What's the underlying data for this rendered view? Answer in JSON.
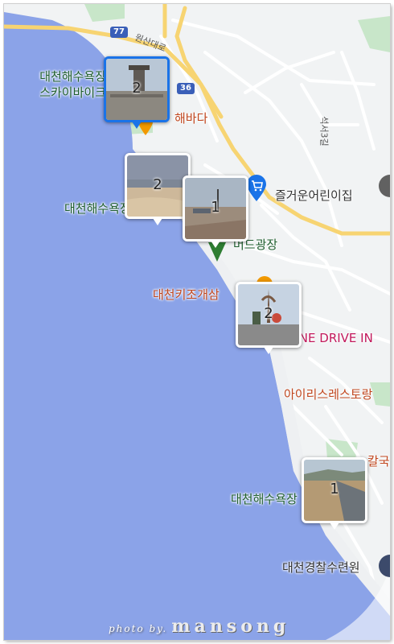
{
  "map": {
    "colors": {
      "sea": "#8ba3e8",
      "land": "#f1f3f4",
      "road_major": "#f7d472",
      "road_minor": "#ffffff",
      "park": "#c8e6c9",
      "selected": "#1a73e8"
    },
    "roads": [
      {
        "number": "77",
        "name": "원산대로"
      },
      {
        "number": "36"
      }
    ],
    "street_labels": [
      "석서3길"
    ],
    "places": [
      {
        "name": "대천해수욕장\n스카이바이크",
        "kind": "park"
      },
      {
        "name": "해바다",
        "kind": "food"
      },
      {
        "name": "즐거운어린이집",
        "kind": "school"
      },
      {
        "name": "대천해수욕장",
        "kind": "park"
      },
      {
        "name": "머드광장",
        "kind": "landmark"
      },
      {
        "name": "대천키조개삼",
        "kind": "food"
      },
      {
        "name": "ONE DRIVE IN",
        "kind": "shop"
      },
      {
        "name": "아이리스레스토랑",
        "kind": "food"
      },
      {
        "name": "칼국",
        "kind": "food"
      },
      {
        "name": "대천해수욕장",
        "kind": "park"
      },
      {
        "name": "대천경찰수련원",
        "kind": "building"
      }
    ],
    "photo_clusters": [
      {
        "count": "2",
        "selected": true
      },
      {
        "count": "2",
        "selected": false
      },
      {
        "count": "1",
        "selected": false
      },
      {
        "count": "2",
        "selected": false
      },
      {
        "count": "1",
        "selected": false
      }
    ]
  },
  "watermark": {
    "prefix": "photo by.",
    "name": "mansong"
  }
}
